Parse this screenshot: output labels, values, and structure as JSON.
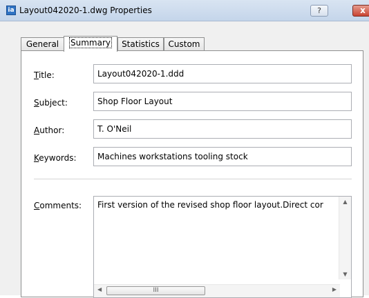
{
  "window": {
    "title": "Layout042020-1.dwg Properties",
    "icon": "dwg-file-icon",
    "help_label": "?",
    "close_label": "x"
  },
  "tabs": [
    {
      "label": "General",
      "active": false
    },
    {
      "label": "Summary",
      "active": true
    },
    {
      "label": "Statistics",
      "active": false
    },
    {
      "label": "Custom",
      "active": false
    }
  ],
  "fields": {
    "title": {
      "label_mnemonic": "T",
      "label_rest": "itle:",
      "value": "Layout042020-1.ddd"
    },
    "subject": {
      "label_mnemonic": "S",
      "label_rest": "ubject:",
      "value": "Shop Floor Layout"
    },
    "author": {
      "label_mnemonic": "A",
      "label_rest": "uthor:",
      "value": "T. O'Neil"
    },
    "keywords": {
      "label_prefix": "",
      "label_mnemonic": "K",
      "label_rest": "eywords:",
      "value": "Machines workstations tooling stock"
    },
    "comments": {
      "label_mnemonic": "C",
      "label_rest": "omments:",
      "value": "First version of the revised shop floor layout.Direct cor"
    }
  },
  "scrollbar": {
    "up_arrow": "▲",
    "down_arrow": "▼",
    "left_arrow": "◀",
    "right_arrow": "▶",
    "thumb_grip": "III"
  },
  "colors": {
    "titlebar": "#d8e4f2",
    "close_button": "#c94332",
    "dialog_bg": "#f0f0f0"
  }
}
